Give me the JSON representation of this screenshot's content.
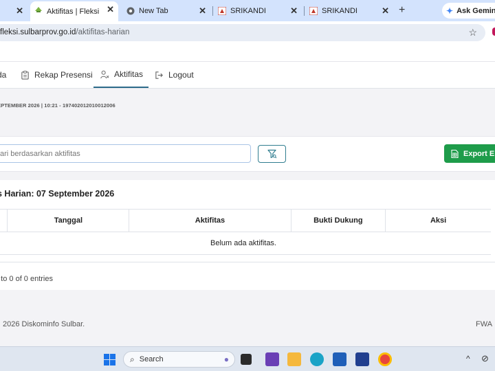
{
  "browser": {
    "tabs": [
      {
        "label": "",
        "active": false
      },
      {
        "label": "Aktifitas | Fleksi",
        "active": true
      },
      {
        "label": "New Tab",
        "active": false
      },
      {
        "label": "SRIKANDI",
        "active": false
      },
      {
        "label": "SRIKANDI",
        "active": false
      }
    ],
    "new_tab_symbol": "+",
    "gemini_label": "Ask Gemini",
    "url_host": "fleksi.sulbarprov.go.id",
    "url_path": "/aktifitas-harian"
  },
  "nav": {
    "items": [
      {
        "label": "da",
        "icon": "home-icon"
      },
      {
        "label": "Rekap Presensi",
        "icon": "clipboard-icon"
      },
      {
        "label": "Aktifitas",
        "icon": "user-x-icon"
      },
      {
        "label": "Logout",
        "icon": "logout-icon"
      }
    ],
    "active_index": 2
  },
  "info_line": "EPTEMBER 2026 | 10:21 - 197402012010012006",
  "search": {
    "placeholder": "ari berdasarkan aktifitas",
    "value": ""
  },
  "export_label": "Export E",
  "card": {
    "title": "s Harian: 07 September 2026",
    "columns": [
      "",
      "Tanggal",
      "Aktifitas",
      "Bukti Dukung",
      "Aksi"
    ],
    "empty_message": "Belum ada aktifitas.",
    "entries_text": "1 to 0 of 0 entries"
  },
  "footer": {
    "left": "2026 Diskominfo Sulbar.",
    "right": "FWA"
  },
  "taskbar": {
    "search_label": "Search"
  },
  "colors": {
    "tabstrip": "#d3e3fd",
    "accent": "#2c6a8a",
    "export_green": "#1e9c4a",
    "search_border": "#a9c4e6"
  }
}
